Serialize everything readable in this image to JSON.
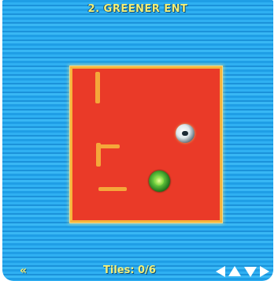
{
  "level": {
    "title": "2. GREENER ENT"
  },
  "status": {
    "back_label": "«",
    "tiles_text": "Tiles: 0/6"
  },
  "board": {
    "floor_color": "#ea3a28",
    "wall_color": "#f5a73a",
    "background_color": "#2fb0f2"
  },
  "icons": {
    "player": "white-orb-icon",
    "goal": "green-orb-icon",
    "controls": [
      "arrow-left-icon",
      "arrow-up-icon",
      "arrow-down-icon",
      "arrow-right-icon"
    ]
  }
}
